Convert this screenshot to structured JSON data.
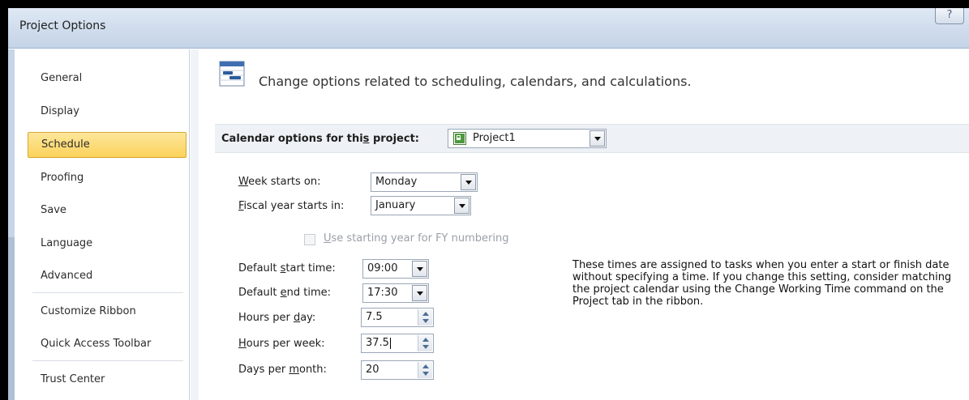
{
  "window": {
    "title": "Project Options",
    "help_label": "?"
  },
  "sidebar": {
    "items": [
      {
        "label": "General"
      },
      {
        "label": "Display"
      },
      {
        "label": "Schedule",
        "active": true
      },
      {
        "label": "Proofing"
      },
      {
        "label": "Save"
      },
      {
        "label": "Language"
      },
      {
        "label": "Advanced"
      },
      {
        "label": "Customize Ribbon"
      },
      {
        "label": "Quick Access Toolbar"
      },
      {
        "label": "Trust Center"
      }
    ]
  },
  "header": {
    "text": "Change options related to scheduling, calendars, and calculations."
  },
  "calendar_section": {
    "label_pre": "Calendar options for thi",
    "label_u": "s",
    "label_post": " project:",
    "project_value": "Project1"
  },
  "form": {
    "week_starts": {
      "u": "W",
      "rest": "eek starts on:",
      "value": "Monday"
    },
    "fiscal_year": {
      "u": "F",
      "rest": "iscal year starts in:",
      "value": "January"
    },
    "fy_numbering": {
      "pre": "",
      "u": "U",
      "rest": "se starting year for FY numbering",
      "checked": false
    },
    "start_time": {
      "pre": "Default ",
      "u": "s",
      "rest": "tart time:",
      "value": "09:00"
    },
    "end_time": {
      "pre": "Default ",
      "u": "e",
      "rest": "nd time:",
      "value": "17:30"
    },
    "hours_day": {
      "pre": "Hours per ",
      "u": "d",
      "rest": "ay:",
      "value": "7.5"
    },
    "hours_week": {
      "pre": "",
      "u": "H",
      "rest": "ours per week:",
      "value": "37.5"
    },
    "days_month": {
      "pre": "Days per ",
      "u": "m",
      "rest": "onth:",
      "value": "20"
    }
  },
  "info": {
    "text": "These times are assigned to tasks when you enter a start or finish date without specifying a time. If you change this setting, consider matching the project calendar using the Change Working Time command on the Project tab in the ribbon."
  },
  "colors": {
    "accent_active": "#fbd25b",
    "titlebar": "#cfdcec",
    "section_bg": "#eef1f5"
  },
  "icons": [
    "help-icon",
    "schedule-gantt-icon",
    "project-file-icon",
    "dropdown-arrow-icon",
    "spinner-arrows-icon"
  ]
}
